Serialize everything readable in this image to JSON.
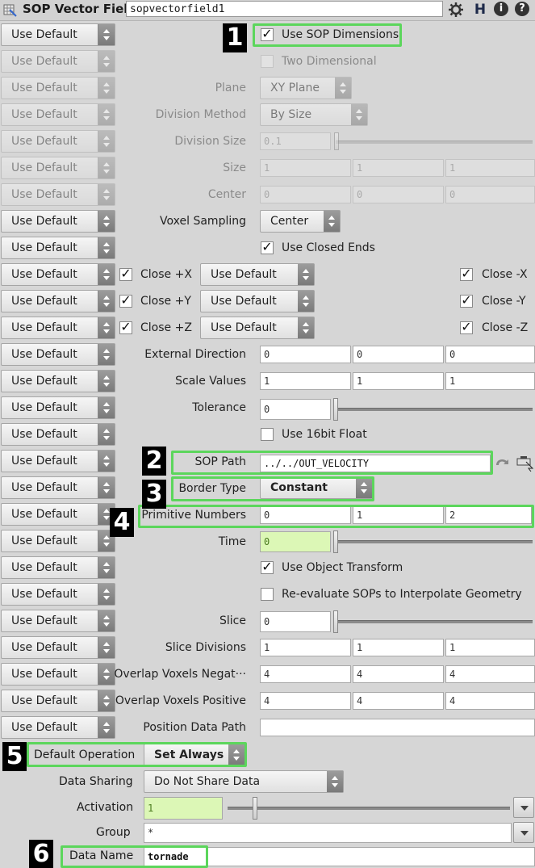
{
  "header": {
    "title": "SOP Vector Field",
    "node_name": "sopvectorfield1",
    "help_glyph": "?",
    "h_glyph": "H",
    "info_glyph": "i"
  },
  "use_default_label": "Use Default",
  "params": {
    "use_sop_dimensions": "Use SOP Dimensions",
    "two_dimensional": "Two Dimensional",
    "plane_label": "Plane",
    "plane_value": "XY Plane",
    "division_method_label": "Division Method",
    "division_method_value": "By Size",
    "division_size_label": "Division Size",
    "division_size_value": "0.1",
    "size_label": "Size",
    "size_values": [
      "1",
      "1",
      "1"
    ],
    "center_label": "Center",
    "center_values": [
      "0",
      "0",
      "0"
    ],
    "voxel_sampling_label": "Voxel Sampling",
    "voxel_sampling_value": "Center",
    "use_closed_ends": "Use Closed Ends",
    "close_px": "Close +X",
    "close_py": "Close +Y",
    "close_pz": "Close +Z",
    "close_nx": "Close -X",
    "close_ny": "Close -Y",
    "close_nz": "Close -Z",
    "external_direction_label": "External Direction",
    "external_direction_values": [
      "0",
      "0",
      "0"
    ],
    "scale_values_label": "Scale Values",
    "scale_values_values": [
      "1",
      "1",
      "1"
    ],
    "tolerance_label": "Tolerance",
    "tolerance_value": "0",
    "use_16bit_float": "Use 16bit Float",
    "sop_path_label": "SOP Path",
    "sop_path_value": "../../OUT_VELOCITY",
    "border_type_label": "Border Type",
    "border_type_value": "Constant",
    "primitive_numbers_label": "Primitive Numbers",
    "primitive_numbers_values": [
      "0",
      "1",
      "2"
    ],
    "time_label": "Time",
    "time_value": "0",
    "use_object_transform": "Use Object Transform",
    "reevaluate": "Re-evaluate SOPs to Interpolate Geometry",
    "slice_label": "Slice",
    "slice_value": "0",
    "slice_divisions_label": "Slice Divisions",
    "slice_divisions_values": [
      "1",
      "1",
      "1"
    ],
    "overlap_neg_label": "Overlap Voxels Negat···",
    "overlap_neg_values": [
      "4",
      "4",
      "4"
    ],
    "overlap_pos_label": "Overlap Voxels Positive",
    "overlap_pos_values": [
      "4",
      "4",
      "4"
    ],
    "position_data_path_label": "Position Data Path",
    "position_data_path_value": ""
  },
  "bottom": {
    "default_operation_label": "Default Operation",
    "default_operation_value": "Set Always",
    "data_sharing_label": "Data Sharing",
    "data_sharing_value": "Do Not Share Data",
    "activation_label": "Activation",
    "activation_value": "1",
    "group_label": "Group",
    "group_value": "*",
    "data_name_label": "Data Name",
    "data_name_value": "tornade"
  },
  "annotations": [
    "1",
    "2",
    "3",
    "4",
    "5",
    "6"
  ],
  "colors": {
    "highlight": "#5cd65c",
    "expression_field": "#dcf7b6"
  }
}
